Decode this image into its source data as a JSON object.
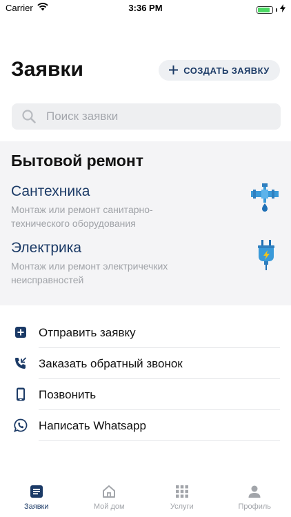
{
  "status_bar": {
    "carrier": "Carrier",
    "time": "3:36 PM",
    "battery_level": 0.85
  },
  "header": {
    "title": "Заявки",
    "create_button": "СОЗДАТЬ ЗАЯВКУ"
  },
  "search": {
    "placeholder": "Поиск заявки"
  },
  "repair": {
    "title": "Бытовой ремонт",
    "services": [
      {
        "name": "Сантехника",
        "description": "Монтаж или ремонт санитарно-технического оборудования",
        "icon": "plumbing-icon"
      },
      {
        "name": "Электрика",
        "description": "Монтаж или ремонт электричечких неисправностей",
        "icon": "electric-plug-icon"
      }
    ]
  },
  "actions": [
    {
      "label": "Отправить заявку",
      "icon": "plus-square-icon"
    },
    {
      "label": "Заказать обратный звонок",
      "icon": "callback-icon"
    },
    {
      "label": "Позвонить",
      "icon": "phone-icon"
    },
    {
      "label": "Написать Whatsapp",
      "icon": "whatsapp-icon"
    }
  ],
  "tabbar": {
    "tabs": [
      {
        "label": "Заявки",
        "icon": "list-icon",
        "active": true
      },
      {
        "label": "Мой дом",
        "icon": "home-icon",
        "active": false
      },
      {
        "label": "Услуги",
        "icon": "grid-icon",
        "active": false
      },
      {
        "label": "Профиль",
        "icon": "person-icon",
        "active": false
      }
    ]
  },
  "colors": {
    "accent": "#1b3a66",
    "muted": "#a0a3a8",
    "section_bg": "#f4f4f6",
    "icon_blue": "#3a9ad9",
    "icon_yellow": "#f2c31b"
  }
}
